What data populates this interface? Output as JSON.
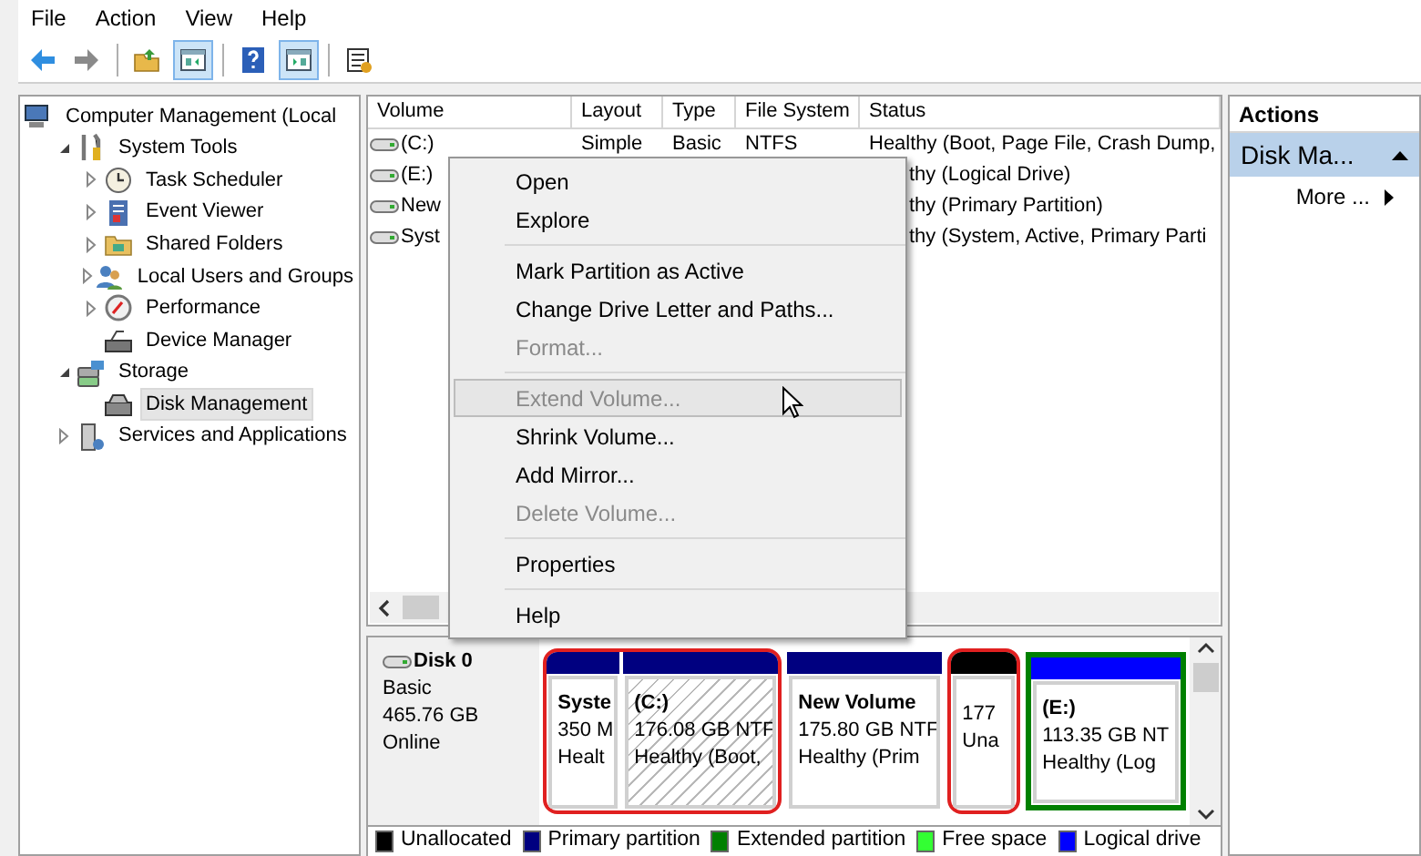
{
  "menu_bar": [
    "File",
    "Action",
    "View",
    "Help"
  ],
  "toolbar": [
    {
      "kind": "back",
      "pressed": false
    },
    {
      "kind": "forward",
      "pressed": false
    },
    {
      "kind": "separator"
    },
    {
      "kind": "up",
      "pressed": false
    },
    {
      "kind": "console_tree",
      "pressed": true
    },
    {
      "kind": "separator"
    },
    {
      "kind": "help",
      "pressed": false
    },
    {
      "kind": "action_pane",
      "pressed": true
    },
    {
      "kind": "separator"
    },
    {
      "kind": "properties",
      "pressed": false
    }
  ],
  "tree": [
    {
      "label": "Computer Management (Local",
      "kind": "computer",
      "selected": false,
      "children": [
        {
          "label": "System Tools",
          "kind": "tools",
          "expanded": true,
          "selected": false,
          "children": [
            {
              "label": "Task Scheduler",
              "kind": "clock",
              "expanded": false,
              "selected": false
            },
            {
              "label": "Event Viewer",
              "kind": "log",
              "expanded": false,
              "selected": false
            },
            {
              "label": "Shared Folders",
              "kind": "folder",
              "expanded": false,
              "selected": false
            },
            {
              "label": "Local Users and Groups",
              "kind": "users",
              "expanded": false,
              "selected": false
            },
            {
              "label": "Performance",
              "kind": "gauge",
              "expanded": false,
              "selected": false
            },
            {
              "label": "Device Manager",
              "kind": "device",
              "selected": false
            }
          ]
        },
        {
          "label": "Storage",
          "kind": "storage",
          "expanded": true,
          "selected": false,
          "children": [
            {
              "label": "Disk Management",
              "kind": "disk",
              "selected": true
            }
          ]
        },
        {
          "label": "Services and Applications",
          "kind": "services",
          "expanded": false,
          "selected": false
        }
      ]
    }
  ],
  "table": {
    "columns": [
      "Volume",
      "Layout",
      "Type",
      "File System",
      "Status"
    ],
    "rows": [
      {
        "volume": "(C:)",
        "layout": "Simple",
        "type": "Basic",
        "file_system": "NTFS",
        "status": "Healthy (Boot, Page File, Crash Dump,"
      },
      {
        "volume": "(E:)",
        "status": "thy (Logical Drive)"
      },
      {
        "volume": "New",
        "status": "thy (Primary Partition)"
      },
      {
        "volume": "Syst",
        "status": "thy (System, Active, Primary Parti"
      }
    ]
  },
  "context_menu": [
    {
      "kind": "item",
      "label": "Open",
      "disabled": false,
      "highlighted": false
    },
    {
      "kind": "item",
      "label": "Explore",
      "disabled": false,
      "highlighted": false
    },
    {
      "kind": "separator"
    },
    {
      "kind": "item",
      "label": "Mark Partition as Active",
      "disabled": false,
      "highlighted": false
    },
    {
      "kind": "item",
      "label": "Change Drive Letter and Paths...",
      "disabled": false,
      "highlighted": false
    },
    {
      "kind": "item",
      "label": "Format...",
      "disabled": true,
      "highlighted": false
    },
    {
      "kind": "separator"
    },
    {
      "kind": "item",
      "label": "Extend Volume...",
      "disabled": true,
      "highlighted": true
    },
    {
      "kind": "item",
      "label": "Shrink Volume...",
      "disabled": false,
      "highlighted": false
    },
    {
      "kind": "item",
      "label": "Add Mirror...",
      "disabled": false,
      "highlighted": false
    },
    {
      "kind": "item",
      "label": "Delete Volume...",
      "disabled": true,
      "highlighted": false
    },
    {
      "kind": "separator"
    },
    {
      "kind": "item",
      "label": "Properties",
      "disabled": false,
      "highlighted": false
    },
    {
      "kind": "separator"
    },
    {
      "kind": "item",
      "label": "Help",
      "disabled": false,
      "highlighted": false
    }
  ],
  "disk": {
    "name": "Disk 0",
    "type": "Basic",
    "size": "465.76 GB",
    "status": "Online"
  },
  "partition_groups": [
    {
      "circled": true,
      "partitions": [
        {
          "kind": "primary",
          "title": "Syste",
          "size": "350 M",
          "status": "Healt",
          "selected": false
        },
        {
          "kind": "primary",
          "title": "(C:)",
          "size": "176.08 GB NTF",
          "status": "Healthy (Boot,",
          "selected": true
        }
      ]
    },
    {
      "circled": false,
      "partitions": [
        {
          "kind": "primary",
          "title": "New Volume",
          "size": "175.80 GB NTF",
          "status": "Healthy (Prim",
          "selected": false
        }
      ]
    },
    {
      "circled": true,
      "partitions": [
        {
          "kind": "unallocated",
          "size": "177",
          "status": "Una",
          "selected": false
        }
      ]
    },
    {
      "circled": false,
      "partitions": [
        {
          "kind": "logical",
          "title": "(E:)",
          "size": "113.35 GB NT",
          "status": "Healthy (Log",
          "selected": false
        }
      ]
    }
  ],
  "legend": [
    {
      "label": "Unallocated",
      "color": "#000000"
    },
    {
      "label": "Primary partition",
      "color": "#000080"
    },
    {
      "label": "Extended partition",
      "color": "#008000"
    },
    {
      "label": "Free space",
      "color": "#33ff33"
    },
    {
      "label": "Logical drive",
      "color": "#0000ff"
    }
  ],
  "actions": {
    "title": "Actions",
    "section": {
      "label": "Disk Ma...",
      "expanded": true
    },
    "items": [
      {
        "label": "More ...",
        "submenu": true
      }
    ]
  }
}
